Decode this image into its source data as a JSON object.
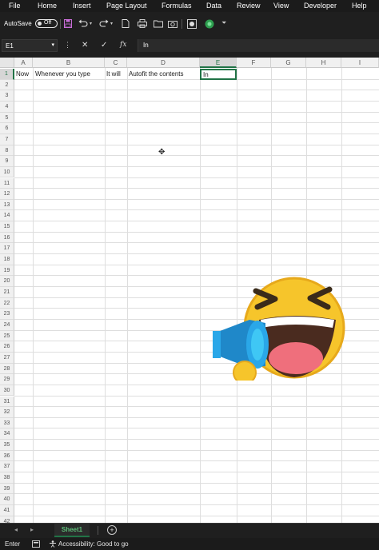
{
  "menu": [
    "File",
    "Home",
    "Insert",
    "Page Layout",
    "Formulas",
    "Data",
    "Review",
    "View",
    "Developer",
    "Help"
  ],
  "quick_access": {
    "autosave_label": "AutoSave",
    "autosave_state": "Off",
    "icons": [
      "save-icon",
      "undo-icon",
      "redo-icon",
      "new-file-icon",
      "print-icon",
      "open-icon",
      "camera-icon",
      "record-icon",
      "more-icon"
    ]
  },
  "formula_bar": {
    "name_box": "E1",
    "dots": "⋮",
    "cancel": "✕",
    "enter": "✓",
    "fx": "fx",
    "content": "In"
  },
  "columns": [
    "A",
    "B",
    "C",
    "D",
    "E",
    "F",
    "G",
    "H",
    "I"
  ],
  "active_column": "E",
  "rows": [
    "1",
    "2",
    "3",
    "4",
    "5",
    "6",
    "7",
    "8",
    "9",
    "10",
    "11",
    "12",
    "13",
    "14",
    "15",
    "16",
    "17",
    "18",
    "19",
    "20",
    "21",
    "22",
    "23",
    "24",
    "25",
    "26",
    "27",
    "28",
    "29",
    "30",
    "31",
    "32",
    "33",
    "34",
    "35",
    "36",
    "37",
    "38",
    "39",
    "40",
    "41",
    "42"
  ],
  "active_row": "1",
  "cells": {
    "A1": "Now",
    "B1": "Whenever you type",
    "C1": "It will",
    "D1": "Autofit the contents",
    "E1": "In"
  },
  "sheet_tabs": {
    "prev": "◂",
    "next": "▸",
    "active_sheet": "Sheet1",
    "add": "+"
  },
  "status_bar": {
    "mode": "Enter",
    "accessibility": "Accessibility: Good to go"
  },
  "colors": {
    "accent": "#217346",
    "emoji_yellow": "#f6c52b",
    "megaphone_blue": "#2aa7e8"
  }
}
